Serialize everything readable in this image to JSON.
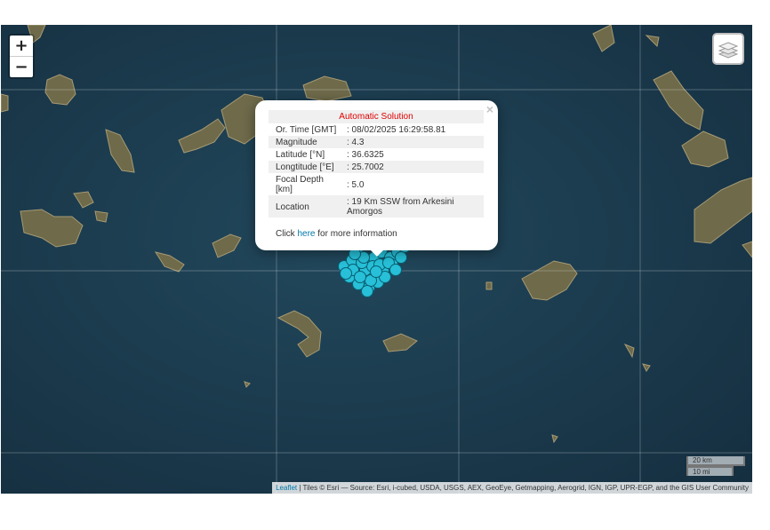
{
  "map": {
    "zoom_in_label": "+",
    "zoom_out_label": "−",
    "layers_icon": "layers-icon",
    "colors": {
      "sea": "#1a3a4e",
      "marker": "#27c0d8",
      "marker_stroke": "#0a5f72"
    }
  },
  "popup": {
    "close_label": "×",
    "title": "Automatic Solution",
    "rows": [
      {
        "key": "Or. Time [GMT]",
        "value": ": 08/02/2025 16:29:58.81"
      },
      {
        "key": "Magnitude",
        "value": ": 4.3"
      },
      {
        "key": "Latitude [°N]",
        "value": ": 36.6325"
      },
      {
        "key": "Longtitude [°E]",
        "value": ": 25.7002"
      },
      {
        "key": "Focal Depth [km]",
        "value": ": 5.0"
      },
      {
        "key": "Location",
        "value": ": 19 Km SSW from Arkesini Amorgos"
      }
    ],
    "more_prefix": "Click ",
    "more_link": "here",
    "more_suffix": " for more information"
  },
  "scale": {
    "metric": "20 km",
    "imperial": "10 mi"
  },
  "attribution": {
    "leaflet_link": "Leaflet",
    "text": " | Tiles © Esri — Source: Esri, i-cubed, USDA, USGS, AEX, GeoEye, Getmapping, Aerogrid, IGN, IGP, UPR-EGP, and the GIS User Community"
  }
}
